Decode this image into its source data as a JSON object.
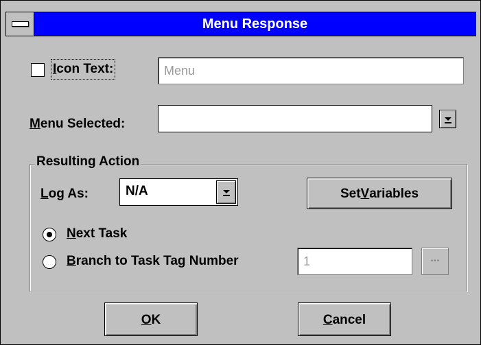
{
  "window": {
    "title": "Menu Response"
  },
  "icon_text": {
    "checked": false,
    "label_pre": "",
    "label_ul": "I",
    "label_post": "con Text:",
    "value": "Menu"
  },
  "menu_selected": {
    "label_ul": "M",
    "label_post": "enu Selected:",
    "value": ""
  },
  "group": {
    "title": "Resulting Action",
    "log_as": {
      "label_ul": "L",
      "label_post": "og As:",
      "value": "N/A"
    },
    "set_variables": {
      "label_pre": "Set ",
      "label_ul": "V",
      "label_post": "ariables"
    },
    "next_task": {
      "label_ul": "N",
      "label_post": "ext Task",
      "selected": true
    },
    "branch": {
      "label_ul": "B",
      "label_post": "ranch to Task Tag Number",
      "selected": false,
      "value": "1",
      "browse_label": "..."
    }
  },
  "buttons": {
    "ok": {
      "label_ul": "O",
      "label_post": "K"
    },
    "cancel": {
      "label_ul": "C",
      "label_post": "ancel"
    }
  }
}
